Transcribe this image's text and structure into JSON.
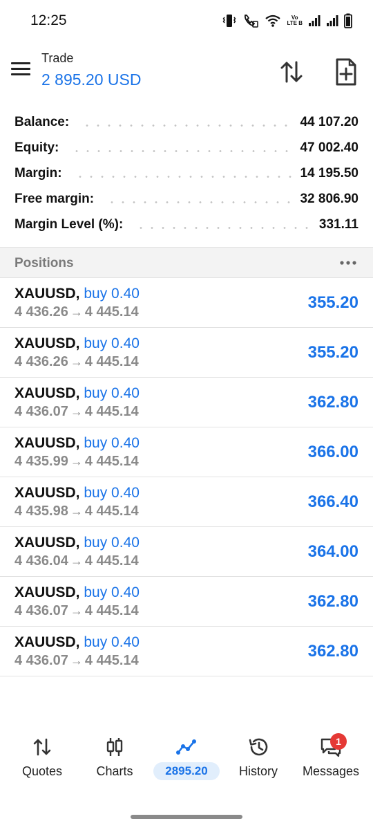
{
  "status_bar": {
    "time": "12:25",
    "icons": [
      "vibrate-icon",
      "wifi-calling-icon",
      "wifi-icon",
      "volte-icon",
      "signal-icon",
      "signal-icon",
      "battery-icon"
    ],
    "volte_text_top": "Vo",
    "volte_text_bottom": "LTE B"
  },
  "header": {
    "title": "Trade",
    "value": "2 895.20 USD",
    "icons": [
      "menu-icon",
      "sort-icon",
      "new-order-icon"
    ]
  },
  "summary": [
    {
      "label": "Balance:",
      "value": "44 107.20"
    },
    {
      "label": "Equity:",
      "value": "47 002.40"
    },
    {
      "label": "Margin:",
      "value": "14 195.50"
    },
    {
      "label": "Free margin:",
      "value": "32 806.90"
    },
    {
      "label": "Margin Level (%):",
      "value": "331.11"
    }
  ],
  "positions": {
    "title": "Positions",
    "arrow": "→",
    "items": [
      {
        "symbol": "XAUUSD,",
        "type": "buy 0.40",
        "open_price": "4 436.26",
        "current_price": "4 445.14",
        "profit": "355.20"
      },
      {
        "symbol": "XAUUSD,",
        "type": "buy 0.40",
        "open_price": "4 436.26",
        "current_price": "4 445.14",
        "profit": "355.20"
      },
      {
        "symbol": "XAUUSD,",
        "type": "buy 0.40",
        "open_price": "4 436.07",
        "current_price": "4 445.14",
        "profit": "362.80"
      },
      {
        "symbol": "XAUUSD,",
        "type": "buy 0.40",
        "open_price": "4 435.99",
        "current_price": "4 445.14",
        "profit": "366.00"
      },
      {
        "symbol": "XAUUSD,",
        "type": "buy 0.40",
        "open_price": "4 435.98",
        "current_price": "4 445.14",
        "profit": "366.40"
      },
      {
        "symbol": "XAUUSD,",
        "type": "buy 0.40",
        "open_price": "4 436.04",
        "current_price": "4 445.14",
        "profit": "364.00"
      },
      {
        "symbol": "XAUUSD,",
        "type": "buy 0.40",
        "open_price": "4 436.07",
        "current_price": "4 445.14",
        "profit": "362.80"
      },
      {
        "symbol": "XAUUSD,",
        "type": "buy 0.40",
        "open_price": "4 436.07",
        "current_price": "4 445.14",
        "profit": "362.80"
      }
    ]
  },
  "bottom_nav": {
    "items": [
      {
        "label": "Quotes",
        "icon": "quotes-icon"
      },
      {
        "label": "Charts",
        "icon": "charts-icon"
      },
      {
        "label": "2895.20",
        "icon": "trade-icon",
        "active": true
      },
      {
        "label": "History",
        "icon": "history-icon"
      },
      {
        "label": "Messages",
        "icon": "messages-icon"
      }
    ],
    "messages_badge": "1"
  },
  "colors": {
    "accent": "#1a73e8",
    "text": "#111111",
    "muted": "#8a8a8a",
    "section_bg": "#f3f3f3",
    "badge": "#e53935",
    "active_pill": "#e1eefc"
  }
}
